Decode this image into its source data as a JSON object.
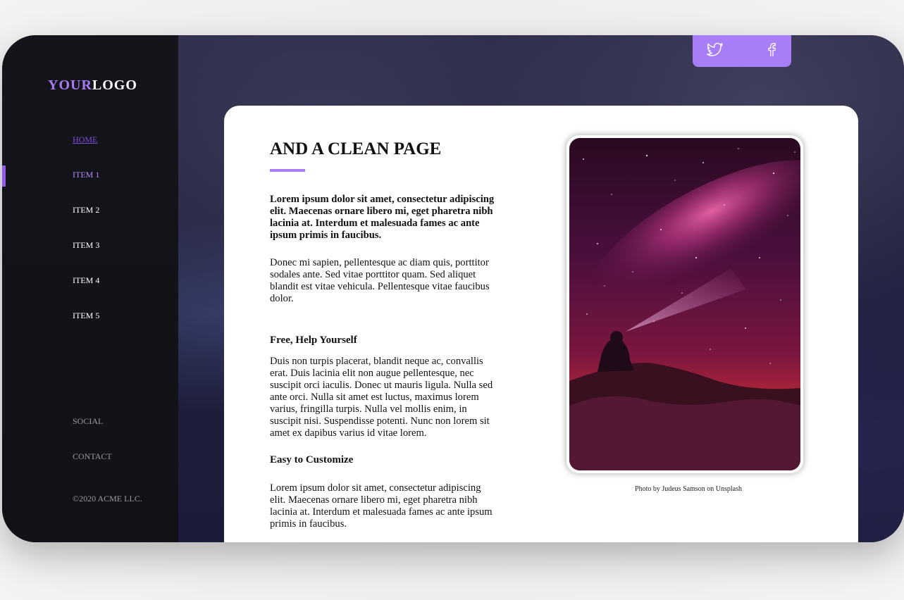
{
  "brand": {
    "logo_part1": "YOUR",
    "logo_part2": "LOGO",
    "accent": "#a77ef8"
  },
  "sidebar": {
    "nav": [
      {
        "label": "HOME"
      },
      {
        "label": "ITEM 1"
      },
      {
        "label": "ITEM 2"
      },
      {
        "label": "ITEM 3"
      },
      {
        "label": "ITEM 4"
      },
      {
        "label": "ITEM 5"
      }
    ],
    "footer": [
      {
        "label": "SOCIAL"
      },
      {
        "label": "CONTACT"
      }
    ],
    "copyright": "©2020 ACME LLC."
  },
  "social": {
    "icons": [
      "twitter-icon",
      "facebook-icon"
    ]
  },
  "content": {
    "title": "AND A CLEAN PAGE",
    "lead": "Lorem ipsum dolor sit amet, consectetur adipiscing elit. Maecenas ornare libero mi, eget pharetra nibh lacinia at. Interdum et malesuada fames ac ante ipsum primis in faucibus.",
    "para1": "Donec mi sapien, pellentesque ac diam quis, porttitor sodales ante. Sed vitae porttitor quam. Sed aliquet blandit est vitae vehicula. Pellentesque vitae faucibus dolor.",
    "section1_heading": "Free, Help Yourself",
    "section1_text": "Duis non turpis placerat, blandit neque ac, convallis erat. Duis lacinia elit non augue pellentesque, nec suscipit orci iaculis. Donec ut mauris ligula. Nulla sed ante orci. Nulla sit amet est luctus, maximus lorem varius, fringilla turpis. Nulla vel mollis enim, in suscipit nisi. Suspendisse potenti. Nunc non lorem sit amet ex dapibus varius id vitae lorem.",
    "section2_heading": "Easy to Customize",
    "section2_text": "Lorem ipsum dolor sit amet, consectetur adipiscing elit. Maecenas ornare libero mi, eget pharetra nibh lacinia at. Interdum et malesuada fames ac ante ipsum primis in faucibus.",
    "photo_caption": "Photo by Judeus Samson on Unsplash"
  }
}
